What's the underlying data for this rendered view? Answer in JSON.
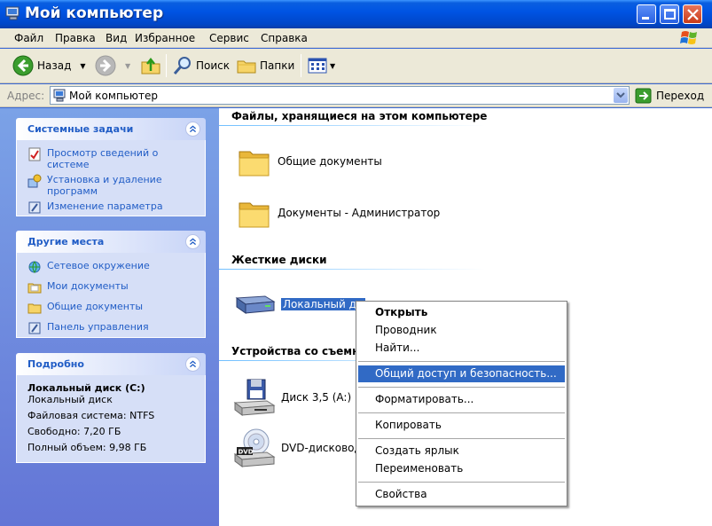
{
  "window": {
    "title": "Мой компьютер"
  },
  "menu": [
    "Файл",
    "Правка",
    "Вид",
    "Избранное",
    "Сервис",
    "Справка"
  ],
  "toolbar": {
    "back": "Назад",
    "search": "Поиск",
    "folders": "Папки"
  },
  "address": {
    "label": "Адрес:",
    "value": "Мой компьютер",
    "go": "Переход"
  },
  "sidebar": {
    "system_tasks": {
      "title": "Системные задачи",
      "items": [
        "Просмотр сведений о системе",
        "Установка и удаление программ",
        "Изменение параметра"
      ]
    },
    "other_places": {
      "title": "Другие места",
      "items": [
        "Сетевое окружение",
        "Мои документы",
        "Общие документы",
        "Панель управления"
      ]
    },
    "details": {
      "title": "Подробно",
      "name": "Локальный диск (C:)",
      "type": "Локальный диск",
      "fs": "Файловая система: NTFS",
      "free": "Свободно: 7,20 ГБ",
      "total": "Полный объем: 9,98 ГБ"
    }
  },
  "main": {
    "sections": {
      "files": "Файлы, хранящиеся на этом компьютере",
      "hdd": "Жесткие диски",
      "removable": "Устройства со съемн"
    },
    "files": [
      "Общие документы",
      "Документы - Администратор"
    ],
    "hdd": [
      "Локальный ди"
    ],
    "removable": [
      "Диск 3,5 (A:)",
      "DVD-дисковод"
    ]
  },
  "context_menu": {
    "items": [
      "Открыть",
      "Проводник",
      "Найти...",
      "Общий доступ и безопасность...",
      "Форматировать...",
      "Копировать",
      "Создать ярлык",
      "Переименовать",
      "Свойства"
    ]
  },
  "colors": {
    "title_blue": "#0054e3",
    "selection": "#316ac5",
    "link": "#215dc6"
  }
}
